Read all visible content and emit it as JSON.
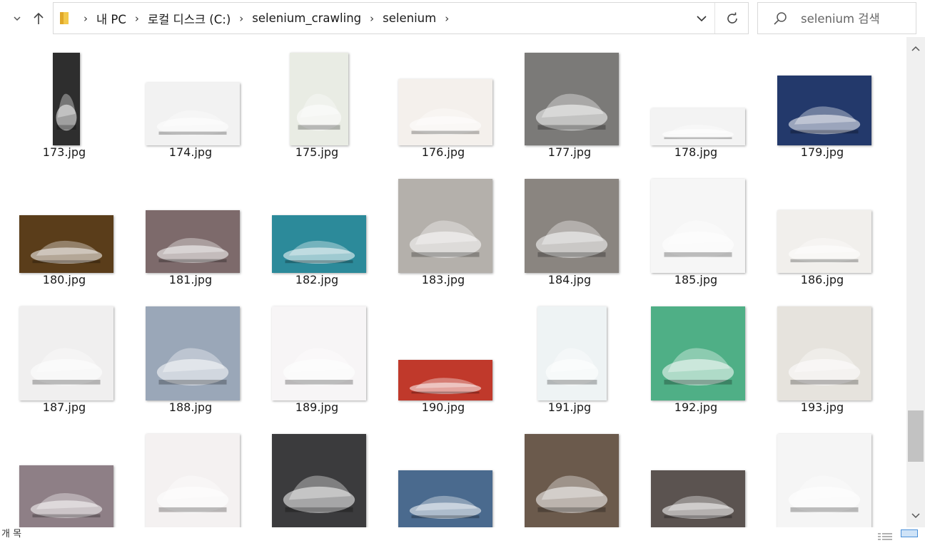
{
  "nav": {
    "back_icon": "chevron-right-icon",
    "up_icon": "up-arrow-icon"
  },
  "address": {
    "crumbs": [
      "내 PC",
      "로컬 디스크 (C:)",
      "selenium_crawling",
      "selenium"
    ]
  },
  "search": {
    "placeholder": "selenium 검색"
  },
  "files": [
    {
      "name": "173.jpg",
      "w": 38,
      "h": 130,
      "bg": "#2e2e2e"
    },
    {
      "name": "174.jpg",
      "w": 132,
      "h": 88,
      "bg": "#f2f2f2"
    },
    {
      "name": "175.jpg",
      "w": 82,
      "h": 130,
      "bg": "#e9ece4"
    },
    {
      "name": "176.jpg",
      "w": 132,
      "h": 93,
      "bg": "#f4f0ec"
    },
    {
      "name": "177.jpg",
      "w": 132,
      "h": 130,
      "bg": "#7b7a78"
    },
    {
      "name": "178.jpg",
      "w": 132,
      "h": 52,
      "bg": "#f3f3f3"
    },
    {
      "name": "179.jpg",
      "w": 132,
      "h": 98,
      "bg": "#23396b"
    },
    {
      "name": "180.jpg",
      "w": 132,
      "h": 81,
      "bg": "#5a3d1a"
    },
    {
      "name": "181.jpg",
      "w": 132,
      "h": 88,
      "bg": "#7d6a6b"
    },
    {
      "name": "182.jpg",
      "w": 132,
      "h": 81,
      "bg": "#2c8a9a"
    },
    {
      "name": "183.jpg",
      "w": 132,
      "h": 132,
      "bg": "#b4b0ab"
    },
    {
      "name": "184.jpg",
      "w": 132,
      "h": 132,
      "bg": "#8a8580"
    },
    {
      "name": "185.jpg",
      "w": 132,
      "h": 132,
      "bg": "#f6f6f6"
    },
    {
      "name": "186.jpg",
      "w": 132,
      "h": 88,
      "bg": "#f1efec"
    },
    {
      "name": "187.jpg",
      "w": 132,
      "h": 132,
      "bg": "#f0efef"
    },
    {
      "name": "188.jpg",
      "w": 132,
      "h": 132,
      "bg": "#9aa7b8"
    },
    {
      "name": "189.jpg",
      "w": 132,
      "h": 132,
      "bg": "#f7f5f6"
    },
    {
      "name": "190.jpg",
      "w": 132,
      "h": 57,
      "bg": "#c0392b"
    },
    {
      "name": "191.jpg",
      "w": 97,
      "h": 132,
      "bg": "#eef3f4"
    },
    {
      "name": "192.jpg",
      "w": 132,
      "h": 132,
      "bg": "#4faf86"
    },
    {
      "name": "193.jpg",
      "w": 132,
      "h": 132,
      "bg": "#e6e3dd"
    },
    {
      "name": "",
      "w": 132,
      "h": 88,
      "bg": "#8e7f86"
    },
    {
      "name": "",
      "w": 132,
      "h": 132,
      "bg": "#f4f1f1"
    },
    {
      "name": "",
      "w": 132,
      "h": 132,
      "bg": "#3b3b3d"
    },
    {
      "name": "",
      "w": 132,
      "h": 81,
      "bg": "#4a6a8e"
    },
    {
      "name": "",
      "w": 132,
      "h": 132,
      "bg": "#6b5a4c"
    },
    {
      "name": "",
      "w": 132,
      "h": 81,
      "bg": "#5b5350"
    },
    {
      "name": "",
      "w": 132,
      "h": 132,
      "bg": "#f5f5f5"
    }
  ],
  "status": {
    "text": "개 목"
  }
}
